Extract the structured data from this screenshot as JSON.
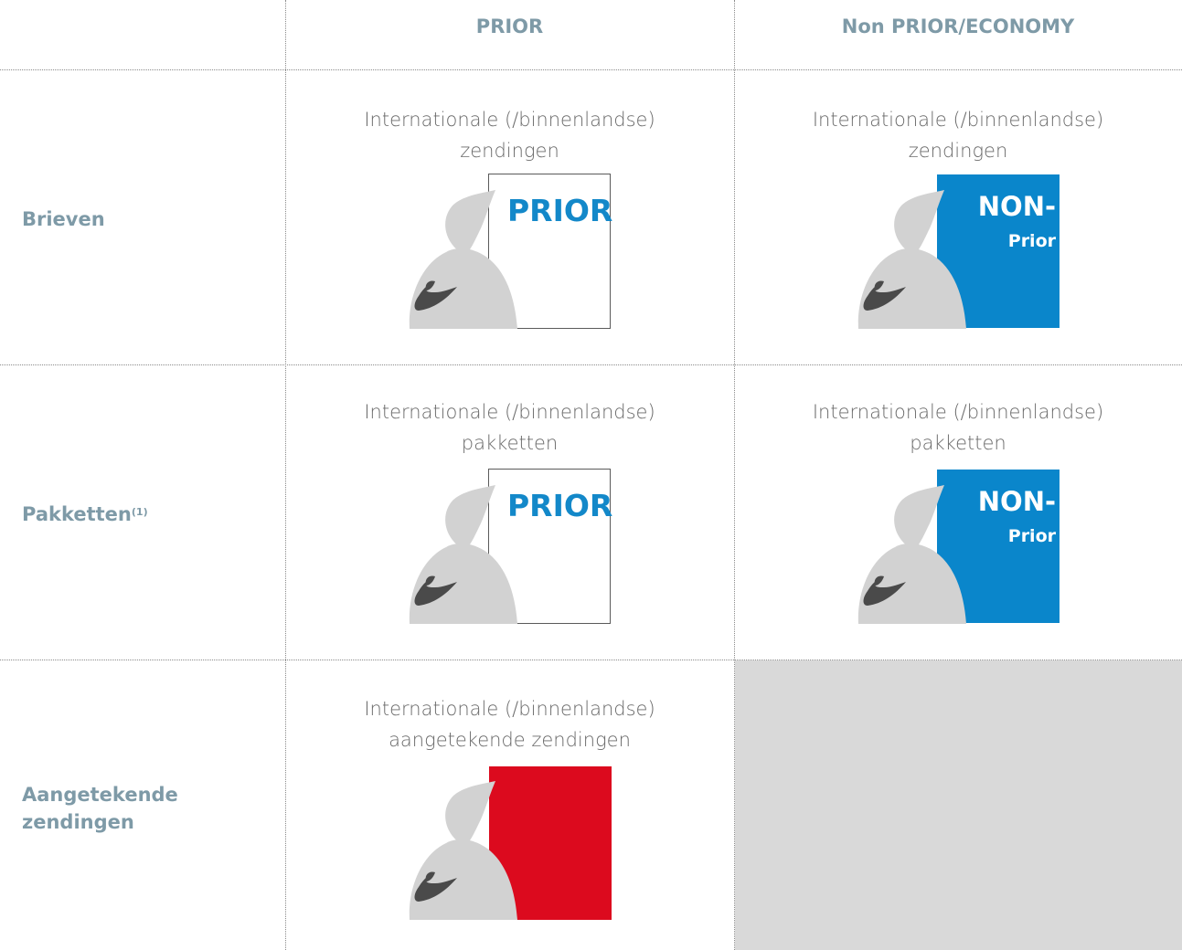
{
  "columns": {
    "prior": "PRIOR",
    "non_prior": "Non PRIOR/ECONOMY"
  },
  "rows": {
    "letters": {
      "label": "Brieven"
    },
    "parcels": {
      "label": "Pakketten",
      "footnote": "(1)"
    },
    "registered": {
      "label_line1": "Aangetekende",
      "label_line2": "zendingen"
    }
  },
  "cells": {
    "letters_prior": {
      "caption_line1": "Internationale (/binnenlandse)",
      "caption_line2": "zendingen",
      "card_label": "PRIOR"
    },
    "letters_non_prior": {
      "caption_line1": "Internationale (/binnenlandse)",
      "caption_line2": "zendingen",
      "card_label_big": "NON-",
      "card_label_small": "Prior"
    },
    "parcels_prior": {
      "caption_line1": "Internationale (/binnenlandse)",
      "caption_line2": "pakketten",
      "card_label": "PRIOR"
    },
    "parcels_non_prior": {
      "caption_line1": "Internationale (/binnenlandse)",
      "caption_line2": "pakketten",
      "card_label_big": "NON-",
      "card_label_small": "Prior"
    },
    "registered_prior": {
      "caption_line1": "Internationale (/binnenlandse)",
      "caption_line2": "aangetekende zendingen"
    }
  },
  "colors": {
    "header_text": "#7e9aa7",
    "prior_blue": "#1388c9",
    "non_prior_blue": "#0a86cb",
    "registered_red": "#dc0a1e",
    "bag_gray": "#d2d2d2",
    "logo_dark": "#4a4a4a",
    "empty_cell_gray": "#d9d9d9"
  },
  "icons": {
    "bag": "postal-bag-icon",
    "logo": "bpost-horn-logo-icon"
  }
}
